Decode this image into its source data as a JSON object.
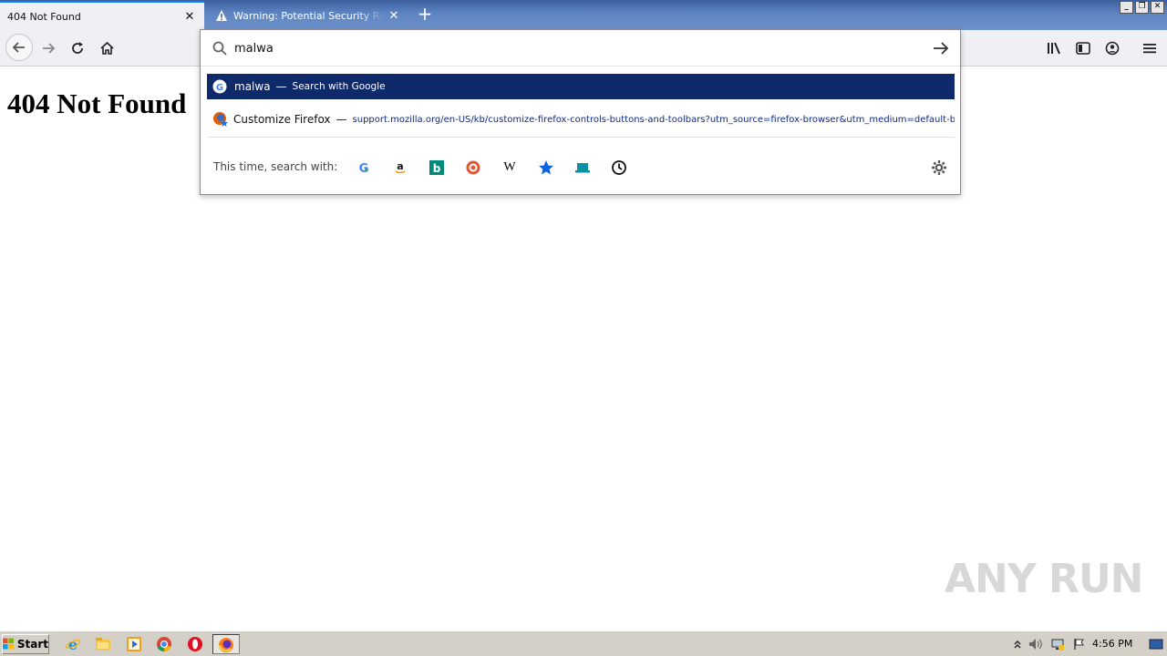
{
  "tabs": [
    {
      "label": "404 Not Found",
      "active": true
    },
    {
      "label": "Warning: Potential Security Risk Ahead",
      "active": false
    }
  ],
  "window_controls": {
    "minimize": "_",
    "restore": "❐",
    "close": "✕"
  },
  "url_bar": {
    "value": "malwa"
  },
  "results": {
    "search": {
      "query": "malwa",
      "dash": "—",
      "action": "Search with Google"
    },
    "bookmark": {
      "title": "Customize Firefox",
      "dash": "—",
      "url": "support.mozilla.org/en-US/kb/customize-firefox-controls-buttons-and-toolbars?utm_source=firefox-browser&utm_medium=default-bookmarks"
    }
  },
  "oneoff": {
    "label": "This time, search with:",
    "engines": [
      "google-icon",
      "amazon-icon",
      "bing-icon",
      "duckduckgo-icon",
      "wikipedia-icon",
      "bookmarks-icon",
      "tabs-icon",
      "history-icon"
    ]
  },
  "page": {
    "heading": "404 Not Found"
  },
  "watermark": "ANY RUN",
  "taskbar": {
    "start": "Start",
    "clock": "4:56 PM"
  },
  "colors": {
    "accent": "#0a84ff",
    "selected_row": "#0f2a6b",
    "titlebar": "#4a6fae"
  }
}
